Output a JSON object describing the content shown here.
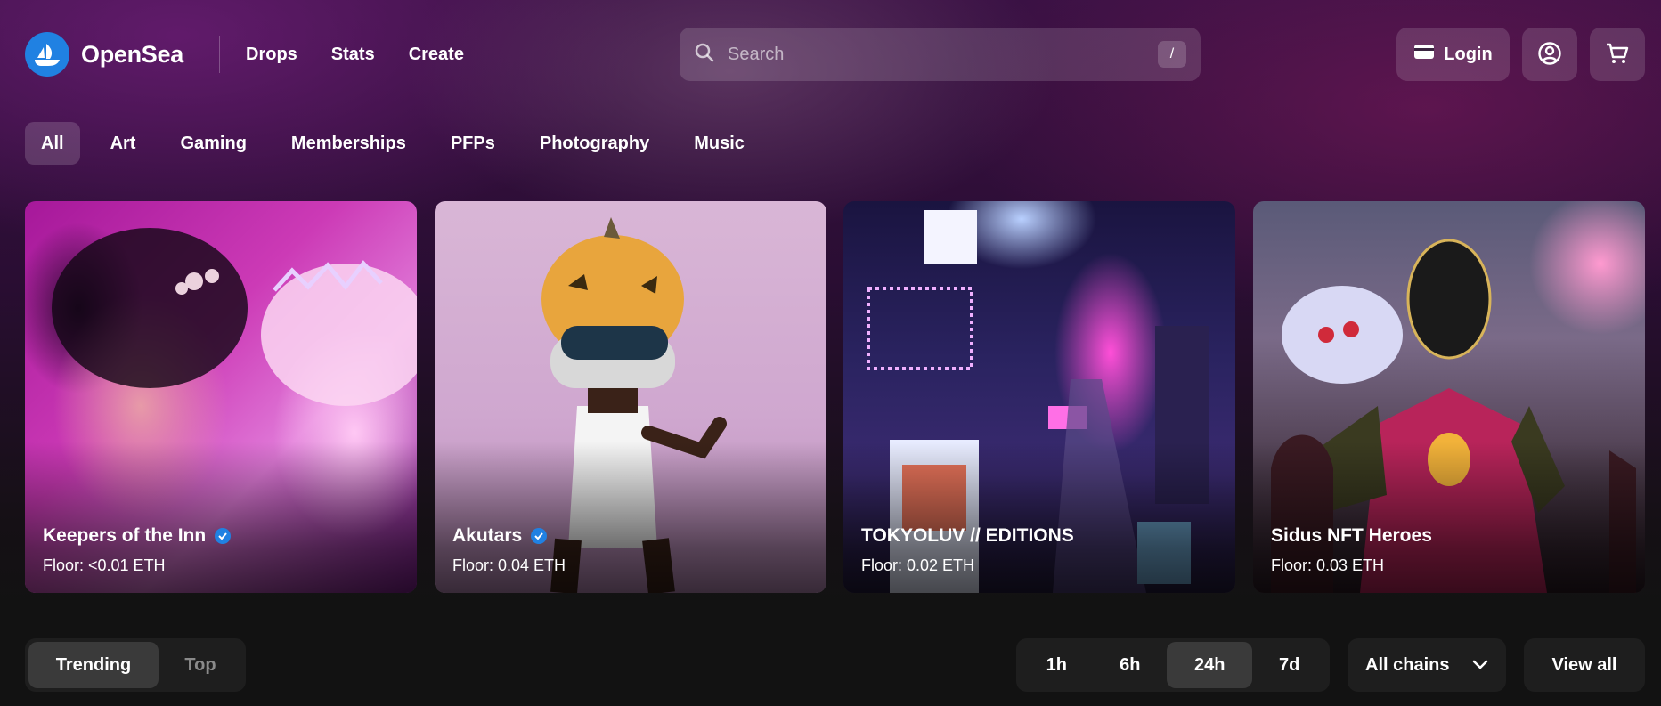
{
  "brand": {
    "name": "OpenSea",
    "color": "#2081e2"
  },
  "nav": {
    "items": [
      "Drops",
      "Stats",
      "Create"
    ]
  },
  "search": {
    "placeholder": "Search",
    "shortcut": "/"
  },
  "header_actions": {
    "login_label": "Login",
    "profile_icon": "account-circle-icon",
    "cart_icon": "cart-icon"
  },
  "categories": {
    "items": [
      "All",
      "Art",
      "Gaming",
      "Memberships",
      "PFPs",
      "Photography",
      "Music"
    ],
    "selected": "All"
  },
  "featured": [
    {
      "name": "Keepers of the Inn",
      "floor": "Floor: <0.01 ETH",
      "verified": true
    },
    {
      "name": "Akutars",
      "floor": "Floor: 0.04 ETH",
      "verified": true
    },
    {
      "name": "TOKYOLUV // EDITIONS",
      "floor": "Floor: 0.02 ETH",
      "verified": false
    },
    {
      "name": "Sidus NFT Heroes",
      "floor": "Floor: 0.03 ETH",
      "verified": false
    }
  ],
  "toolbar": {
    "ranking_tabs": [
      "Trending",
      "Top"
    ],
    "ranking_selected": "Trending",
    "time_ranges": [
      "1h",
      "6h",
      "24h",
      "7d"
    ],
    "time_selected": "24h",
    "chain_select": "All chains",
    "view_all_label": "View all"
  }
}
